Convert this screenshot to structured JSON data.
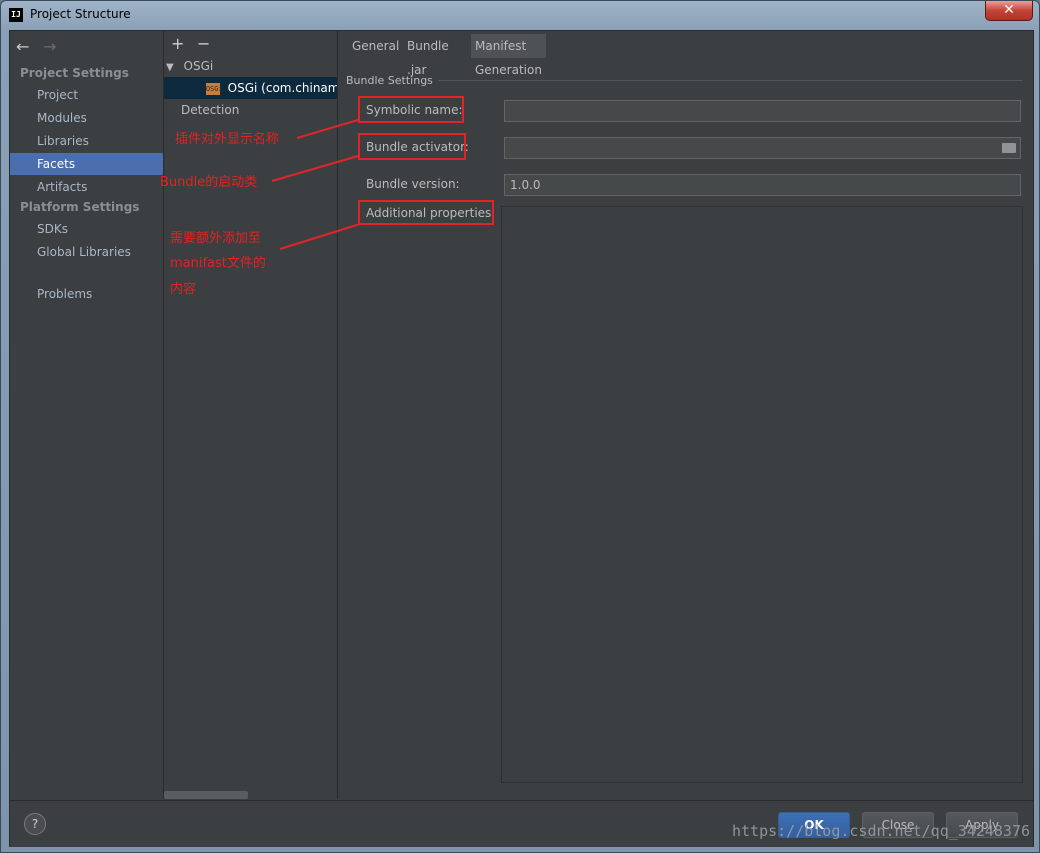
{
  "window": {
    "title": "Project Structure",
    "app_icon_text": "IJ",
    "close_glyph": "✕"
  },
  "sidebar": {
    "back_glyph": "←",
    "forward_glyph": "→",
    "sections": [
      {
        "header": "Project Settings",
        "items": [
          "Project",
          "Modules",
          "Libraries",
          "Facets",
          "Artifacts"
        ]
      },
      {
        "header": "Platform Settings",
        "items": [
          "SDKs",
          "Global Libraries"
        ]
      }
    ],
    "problems": "Problems",
    "selected": "Facets"
  },
  "tree": {
    "add_glyph": "+",
    "remove_glyph": "−",
    "root": "OSGi",
    "root_arrow": "▼",
    "child_badge": "OSGi",
    "child": "OSGi (com.chinamol",
    "detection": "Detection"
  },
  "tabs": [
    "General",
    "Bundle .jar",
    "Manifest Generation"
  ],
  "active_tab": "Manifest Generation",
  "form": {
    "group_title": "Bundle Settings",
    "symbolic_name": {
      "label": "Symbolic name:",
      "value": ""
    },
    "bundle_activator": {
      "label": "Bundle activator:",
      "value": ""
    },
    "bundle_version": {
      "label": "Bundle version:",
      "value": "1.0.0"
    },
    "additional_properties": {
      "label": "Additional properties:",
      "value": ""
    }
  },
  "buttons": {
    "help": "?",
    "ok": "OK",
    "close": "Close",
    "apply": "Apply"
  },
  "annotations": {
    "symbolic": "插件对外显示名称",
    "activator": "Bundle的启动类",
    "additional_line1": "需要额外添加至",
    "additional_line2": "manifast文件的",
    "additional_line3": "内容",
    "color": "#e0242a"
  },
  "watermark": "https://blog.csdn.net/qq_34248376"
}
